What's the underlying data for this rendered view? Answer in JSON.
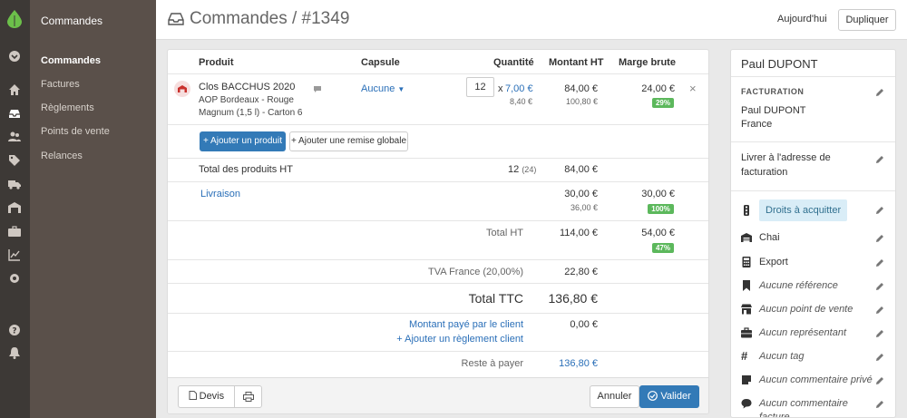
{
  "menu": {
    "heading": "Commandes",
    "items": [
      {
        "label": "Commandes",
        "active": true
      },
      {
        "label": "Factures",
        "active": false
      },
      {
        "label": "Règlements",
        "active": false
      },
      {
        "label": "Points de vente",
        "active": false
      },
      {
        "label": "Relances",
        "active": false
      }
    ]
  },
  "header": {
    "title": "Commandes / #1349",
    "today_label": "Aujourd'hui",
    "duplicate_label": "Dupliquer"
  },
  "table": {
    "headers": {
      "product": "Produit",
      "capsule": "Capsule",
      "quantity": "Quantité",
      "amount": "Montant HT",
      "margin": "Marge brute"
    },
    "product": {
      "name": "Clos BACCHUS 2020",
      "line2": "AOP Bordeaux - Rouge",
      "line3": "Magnum (1,5 l) - Carton 6",
      "capsule": "Aucune",
      "qty": "12",
      "times": "x",
      "unit_price": "7,00 €",
      "unit_price_ttc": "8,40 €",
      "amount": "84,00 €",
      "amount_ttc": "100,80 €",
      "margin": "24,00 €",
      "margin_pct": "29%",
      "remove": "×"
    },
    "add_product": "+ Ajouter un produit",
    "add_discount": "+ Ajouter une remise globale",
    "total_products_label": "Total des produits HT",
    "total_products_qty": "12",
    "total_products_qty_sub": "(24)",
    "total_products_amount": "84,00 €",
    "delivery": {
      "label": "Livraison",
      "amount": "30,00 €",
      "amount_ttc": "36,00 €",
      "margin": "30,00 €",
      "margin_pct": "100%"
    },
    "total_ht": {
      "label": "Total HT",
      "amount": "114,00 €",
      "margin": "54,00 €",
      "margin_pct": "47%"
    },
    "tva": {
      "label": "TVA France (20,00%)",
      "amount": "22,80 €"
    },
    "total_ttc": {
      "label": "Total TTC",
      "amount": "136,80 €"
    },
    "paid": {
      "label": "Montant payé par le client",
      "amount": "0,00 €",
      "add_label": "+ Ajouter un règlement client"
    },
    "remaining": {
      "label": "Reste à payer",
      "amount": "136,80 €"
    }
  },
  "footer": {
    "quote_label": "Devis",
    "cancel_label": "Annuler",
    "validate_label": "Valider"
  },
  "client": {
    "name": "Paul DUPONT",
    "billing_heading": "FACTURATION",
    "billing_name": "Paul DUPONT",
    "billing_country": "France",
    "delivery_line1": "Livrer à l'adresse de",
    "delivery_line2": "facturation",
    "rows": [
      {
        "icon": "traffic-light-icon",
        "label": "Droits à acquitter",
        "style": "tag"
      },
      {
        "icon": "warehouse-icon",
        "label": "Chai",
        "style": "normal"
      },
      {
        "icon": "calculator-icon",
        "label": "Export",
        "style": "normal"
      },
      {
        "icon": "bookmark-icon",
        "label": "Aucune référence",
        "style": "italic"
      },
      {
        "icon": "store-icon",
        "label": "Aucun point de vente",
        "style": "italic"
      },
      {
        "icon": "briefcase-icon",
        "label": "Aucun représentant",
        "style": "italic"
      },
      {
        "icon": "hashtag-icon",
        "label": "Aucun tag",
        "style": "italic"
      },
      {
        "icon": "note-icon",
        "label": "Aucun commentaire privé",
        "style": "italic"
      },
      {
        "icon": "comment-icon",
        "label": "Aucun commentaire",
        "style": "italic",
        "line2": "facture"
      }
    ]
  },
  "colors": {
    "rail": "#3d3936",
    "menu": "#5a504a",
    "primary": "#337ab7",
    "badge": "#5cb85c",
    "link": "#2a6fb8",
    "logo": "#6cc04a"
  }
}
